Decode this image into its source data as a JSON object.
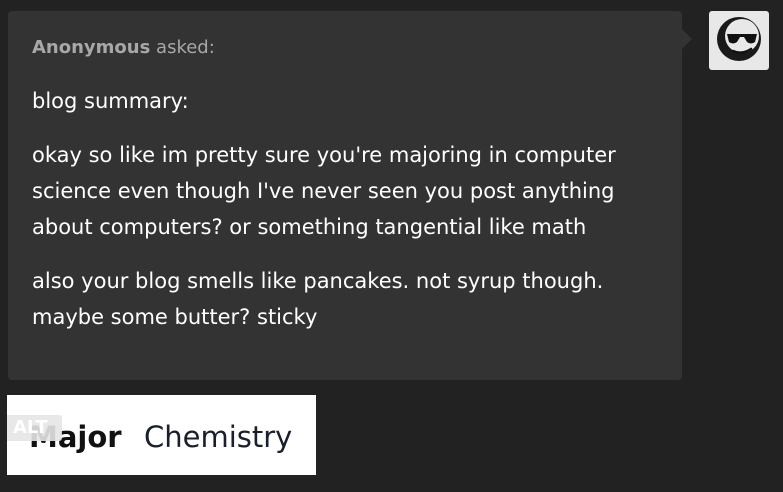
{
  "ask": {
    "asker_name": "Anonymous",
    "asked_suffix": " asked:",
    "paragraphs": [
      "blog summary:",
      "okay so like im pretty sure you're majoring in computer science even though I've never seen you post anything about computers? or something tangential like math",
      "also your blog smells like pancakes. not syrup though. maybe some butter? sticky"
    ]
  },
  "avatar": {
    "icon": "sunglasses-face-icon"
  },
  "answer_image": {
    "alt_badge": "ALT",
    "major_label": "Major",
    "major_value": "Chemistry"
  },
  "colors": {
    "background": "#222222",
    "bubble": "#333333",
    "asker_text": "#a8a8a8",
    "body_text": "#ffffff"
  }
}
